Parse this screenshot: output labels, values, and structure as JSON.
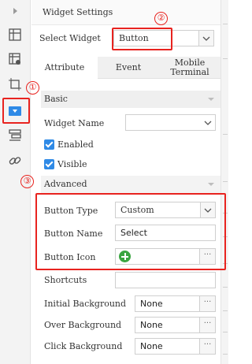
{
  "panel": {
    "title": "Widget Settings",
    "select_widget_label": "Select Widget",
    "select_widget_value": "Button"
  },
  "tabs": [
    {
      "label": "Attribute",
      "active": true
    },
    {
      "label": "Event",
      "active": false
    },
    {
      "label": "Mobile Terminal",
      "active": false
    }
  ],
  "basic": {
    "title": "Basic",
    "widget_name_label": "Widget Name",
    "widget_name_value": "",
    "enabled_label": "Enabled",
    "enabled_checked": true,
    "visible_label": "Visible",
    "visible_checked": true
  },
  "advanced": {
    "title": "Advanced",
    "button_type_label": "Button Type",
    "button_type_value": "Custom",
    "button_name_label": "Button Name",
    "button_name_value": "Select",
    "button_icon_label": "Button Icon",
    "shortcuts_label": "Shortcuts",
    "shortcuts_value": "",
    "initial_bg_label": "Initial Background",
    "initial_bg_value": "None",
    "over_bg_label": "Over Background",
    "over_bg_value": "None",
    "click_bg_label": "Click Background",
    "click_bg_value": "None",
    "more_label": "···"
  },
  "annotations": {
    "step1": "①",
    "step2": "②",
    "step3": "③"
  },
  "colors": {
    "highlight": "#e8231f",
    "accent": "#2f8ae6",
    "icon_green": "#3aa540"
  }
}
